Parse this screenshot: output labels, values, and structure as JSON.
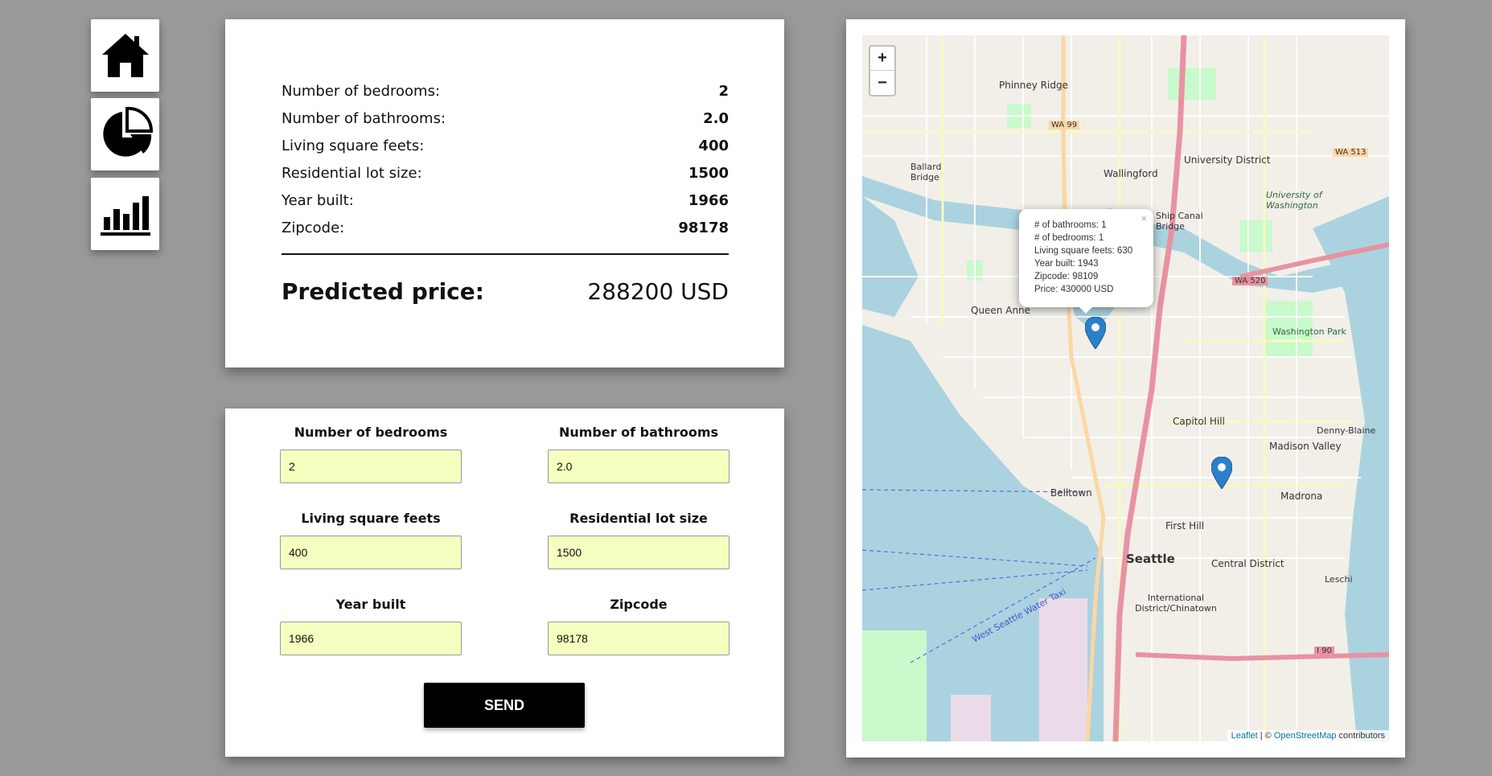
{
  "nav": {
    "items": [
      {
        "id": "home",
        "icon": "home-icon"
      },
      {
        "id": "stats",
        "icon": "pie-chart-icon"
      },
      {
        "id": "charts",
        "icon": "bar-chart-icon"
      }
    ]
  },
  "result": {
    "rows": [
      {
        "label": "Number of bedrooms:",
        "value": "2"
      },
      {
        "label": "Number of bathrooms:",
        "value": "2.0"
      },
      {
        "label": "Living square feets:",
        "value": "400"
      },
      {
        "label": "Residential lot size:",
        "value": "1500"
      },
      {
        "label": "Year built:",
        "value": "1966"
      },
      {
        "label": "Zipcode:",
        "value": "98178"
      }
    ],
    "predicted_label": "Predicted price:",
    "predicted_value": "288200 USD"
  },
  "form": {
    "bedrooms": {
      "label": "Number of bedrooms",
      "value": "2"
    },
    "bathrooms": {
      "label": "Number of bathrooms",
      "value": "2.0"
    },
    "living": {
      "label": "Living square feets",
      "value": "400"
    },
    "lot": {
      "label": "Residential lot size",
      "value": "1500"
    },
    "year": {
      "label": "Year built",
      "value": "1966"
    },
    "zipcode": {
      "label": "Zipcode",
      "value": "98178"
    },
    "send_label": "SEND"
  },
  "map": {
    "zoom_in": "+",
    "zoom_out": "−",
    "popup": {
      "close": "×",
      "lines": [
        "# of bathrooms: 1",
        "# of bedrooms: 1",
        "Living square feets: 630",
        "Year built: 1943",
        "Zipcode: 98109",
        "Price: 430000 USD"
      ]
    },
    "attribution": {
      "leaflet": "Leaflet",
      "sep": " | © ",
      "osm": "OpenStreetMap",
      "rest": " contributors"
    },
    "labels": {
      "seattle": "Seattle",
      "phinney": "Phinney Ridge",
      "wallingford": "Wallingford",
      "university_district": "University District",
      "uw": "University of Washington",
      "queen_anne": "Queen Anne",
      "capitol_hill": "Capitol Hill",
      "madison_valley": "Madison Valley",
      "belltown": "Belltown",
      "first_hill": "First Hill",
      "central_district": "Central District",
      "madrona": "Madrona",
      "intl_district": "International District/Chinatown",
      "washington_park": "Washington Park",
      "denny_blaine": "Denny-Blaine",
      "ballard_bridge": "Ballard Bridge",
      "ship_canal": "Ship Canal Bridge",
      "leschi": "Leschi",
      "water_taxi": "West Seattle Water Taxi",
      "wa99": "WA 99",
      "wa520": "WA 520",
      "i90": "I 90",
      "wa513": "WA 513"
    }
  }
}
